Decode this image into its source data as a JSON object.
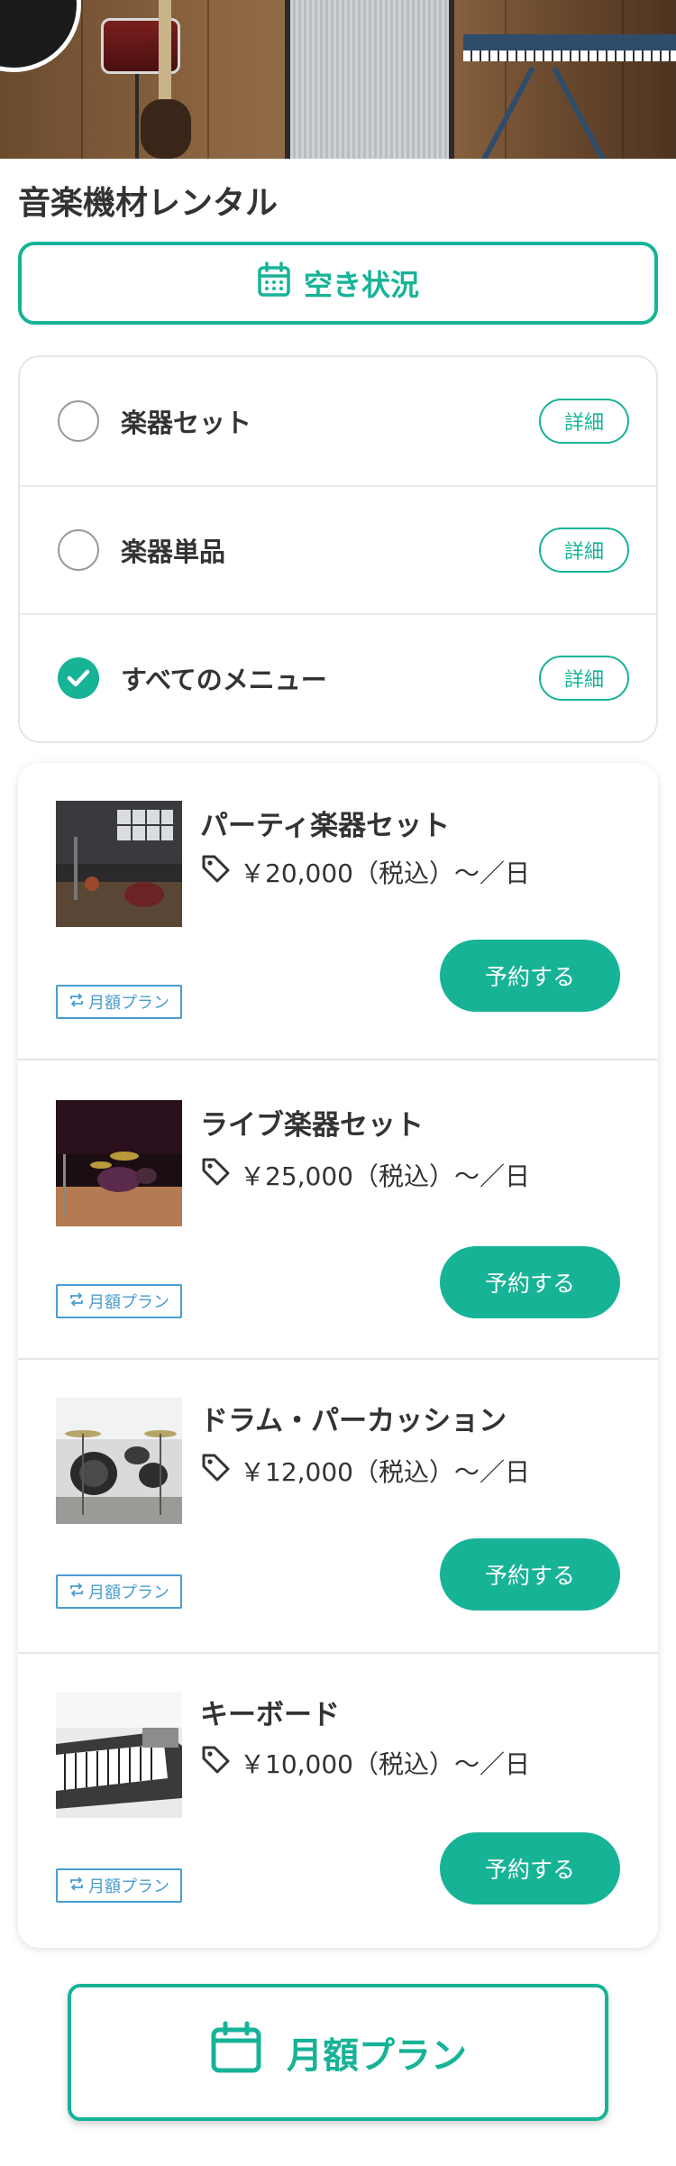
{
  "page": {
    "title": "音楽機材レンタル",
    "availability_label": "空き状況",
    "monthly_plan_label": "月額プラン"
  },
  "menu": {
    "options": [
      {
        "label": "楽器セット",
        "detail": "詳細",
        "checked": false
      },
      {
        "label": "楽器単品",
        "detail": "詳細",
        "checked": false
      },
      {
        "label": "すべてのメニュー",
        "detail": "詳細",
        "checked": true
      }
    ]
  },
  "items": [
    {
      "name": "パーティ楽器セット",
      "price": "￥20,000（税込）〜／日",
      "badge": "月額プラン",
      "reserve": "予約する"
    },
    {
      "name": "ライブ楽器セット",
      "price": "￥25,000（税込）〜／日",
      "badge": "月額プラン",
      "reserve": "予約する"
    },
    {
      "name": "ドラム・パーカッション",
      "price": "￥12,000（税込）〜／日",
      "badge": "月額プラン",
      "reserve": "予約する"
    },
    {
      "name": "キーボード",
      "price": "￥10,000（税込）〜／日",
      "badge": "月額プラン",
      "reserve": "予約する"
    }
  ],
  "colors": {
    "accent": "#17b397",
    "badge": "#4a9ccf",
    "text": "#333333"
  },
  "icons": [
    "calendar-icon",
    "check-icon",
    "price-tag-icon",
    "repeat-icon"
  ]
}
